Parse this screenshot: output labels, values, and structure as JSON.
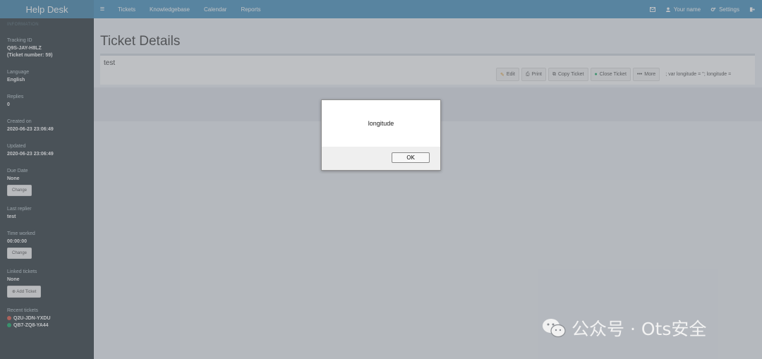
{
  "header": {
    "brand": "Help Desk",
    "menu_icon": "menu-icon",
    "nav": [
      "Tickets",
      "Knowledgebase",
      "Calendar",
      "Reports"
    ],
    "user_name": "Your name",
    "settings": "Settings"
  },
  "sidebar": {
    "section_title": "INFORMATION",
    "tracking_label": "Tracking ID",
    "tracking_id": "Q9S-JAY-H8LZ",
    "ticket_number": "(Ticket number: 59)",
    "language_label": "Language",
    "language": "English",
    "replies_label": "Replies",
    "replies": "0",
    "created_label": "Created on",
    "created": "2020-06-23 23:06:49",
    "updated_label": "Updated",
    "updated": "2020-06-23 23:06:49",
    "due_label": "Due Date",
    "due": "None",
    "change_label": "Change",
    "last_replier_label": "Last replier",
    "last_replier": "test",
    "time_worked_label": "Time worked",
    "time_worked": "00:00:00",
    "linked_label": "Linked tickets",
    "linked": "None",
    "add_ticket": "Add Ticket",
    "recent_label": "Recent tickets",
    "recent": [
      {
        "id": "Q2U-JDN-YXDU",
        "color": "#dd4b39"
      },
      {
        "id": "QB7-ZQ8-YA44",
        "color": "#00a65a"
      }
    ]
  },
  "main": {
    "title": "Ticket Details",
    "ticket_text": "test",
    "actions": [
      "Edit",
      "Print",
      "Copy Ticket",
      "Close Ticket",
      "More"
    ],
    "script_text": "; var longitude = ''; longitude ="
  },
  "dialog": {
    "message": "longitude",
    "ok": "OK"
  },
  "watermark": {
    "text": "公众号 · Ots安全"
  },
  "colors": {
    "header": "#3c8dbc",
    "brand": "#367fa9",
    "sidebar": "#222d32"
  }
}
